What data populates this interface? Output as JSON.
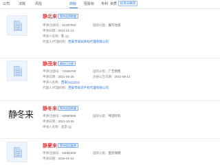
{
  "tabs": [
    {
      "label": "公司"
    },
    {
      "label": "法院"
    },
    {
      "label": "风险"
    },
    {
      "label": "商标"
    },
    {
      "label": "招投标"
    },
    {
      "label": "专利"
    },
    {
      "label": "资质"
    },
    {
      "label": "投资与融资"
    }
  ],
  "active_tab": "商标",
  "labels": {
    "reg_no": "申请/注册号：",
    "intl_class": "国际分类：",
    "apply_date": "申请日期：",
    "publish_date": "注册公告日期：",
    "applicant": "申请人名称：",
    "agent": "代理人/代理机构："
  },
  "cards": [
    {
      "name": "静北来",
      "status": "等待实质审查",
      "reg_no": "61337062",
      "intl_class": "餐饮住宿",
      "apply_date": "2021-01-13",
      "applicant": "陈",
      "agent": "西安市高知商标代理有限公司"
    },
    {
      "name": "静茂来",
      "status": "商标已注册",
      "reg_no": "71508760",
      "intl_class": "广告销售",
      "apply_date": "2021-05-25",
      "publish_date": "2021-09-14",
      "applicant": "西安",
      "agent": "西安市知识产权代理有限公司"
    },
    {
      "name": "静冬来",
      "logo_text": "静冬来",
      "status": "等待实质审查",
      "reg_no": "52580066",
      "intl_class": "啤酒饮料",
      "apply_date": "2021-10-25",
      "applicant": "北京"
    },
    {
      "name": "静夏来",
      "status": "等待驳回复审",
      "reg_no": "53091000",
      "intl_class": "医药保健",
      "apply_date": "2020-01-12"
    }
  ]
}
